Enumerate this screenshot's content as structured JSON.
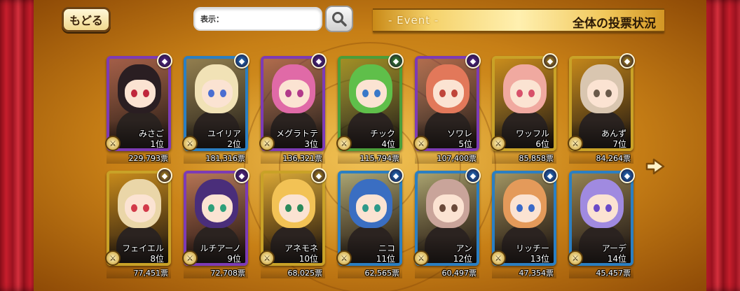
{
  "header": {
    "back_label": "もどる",
    "search_label": "表示：",
    "search_value": "",
    "event_label": "- Event -",
    "title": "全体の投票状況"
  },
  "cards": [
    {
      "name": "みさご",
      "rank": "1位",
      "votes": "229,793票",
      "frame": "#7d3bb5",
      "attr": "#5b2a8e",
      "hair": "#2a1e22",
      "eye": "#c0263c"
    },
    {
      "name": "ユイリア",
      "rank": "2位",
      "votes": "181,316票",
      "frame": "#2b7fc2",
      "attr": "#2376c8",
      "hair": "#f1e2b6",
      "eye": "#4a6ed1"
    },
    {
      "name": "メグラトテ",
      "rank": "3位",
      "votes": "136,321票",
      "frame": "#7d3bb5",
      "attr": "#5b2a8e",
      "hair": "#e06aa7",
      "eye": "#b23a8a"
    },
    {
      "name": "チック",
      "rank": "4位",
      "votes": "115,794票",
      "frame": "#4a9e3a",
      "attr": "#3a8e2c",
      "hair": "#5fbf4a",
      "eye": "#3a78c8"
    },
    {
      "name": "ソワレ",
      "rank": "5位",
      "votes": "107,400票",
      "frame": "#7d3bb5",
      "attr": "#5b2a8e",
      "hair": "#e2785a",
      "eye": "#c0453a"
    },
    {
      "name": "ワッフル",
      "rank": "6位",
      "votes": "85,858票",
      "frame": "#c9a227",
      "attr": "#b88f18",
      "hair": "#f0a9a0",
      "eye": "#d8506a"
    },
    {
      "name": "あんず",
      "rank": "7位",
      "votes": "84,264票",
      "frame": "#c9a227",
      "attr": "#b88f18",
      "hair": "#d9c6b0",
      "eye": "#6a5a4a"
    },
    {
      "name": "フェイエル",
      "rank": "8位",
      "votes": "77,451票",
      "frame": "#c9a227",
      "attr": "#b88f18",
      "hair": "#ead6a8",
      "eye": "#d23a4a"
    },
    {
      "name": "ルチアーノ",
      "rank": "9位",
      "votes": "72,708票",
      "frame": "#7d3bb5",
      "attr": "#5b2a8e",
      "hair": "#4a2e7a",
      "eye": "#2ea07a"
    },
    {
      "name": "アネモネ",
      "rank": "10位",
      "votes": "68,025票",
      "frame": "#c9a227",
      "attr": "#b88f18",
      "hair": "#f2c255",
      "eye": "#2a8a5a"
    },
    {
      "name": "ニコ",
      "rank": "11位",
      "votes": "62,565票",
      "frame": "#2b7fc2",
      "attr": "#2376c8",
      "hair": "#3a6ec2",
      "eye": "#2e9a8a"
    },
    {
      "name": "アン",
      "rank": "12位",
      "votes": "60,497票",
      "frame": "#2b7fc2",
      "attr": "#2376c8",
      "hair": "#c9a49a",
      "eye": "#6a4a3a"
    },
    {
      "name": "リッチー",
      "rank": "13位",
      "votes": "47,354票",
      "frame": "#2b7fc2",
      "attr": "#2376c8",
      "hair": "#e49a5a",
      "eye": "#3a6ac8"
    },
    {
      "name": "アーデ",
      "rank": "14位",
      "votes": "45,457票",
      "frame": "#2b7fc2",
      "attr": "#2376c8",
      "hair": "#a08ae0",
      "eye": "#6a4ac8"
    }
  ],
  "icons": {
    "search": "search-icon",
    "next": "next-arrow-icon"
  },
  "colors": {
    "stage": "#d99a24",
    "curtain": "#b81c2a"
  }
}
